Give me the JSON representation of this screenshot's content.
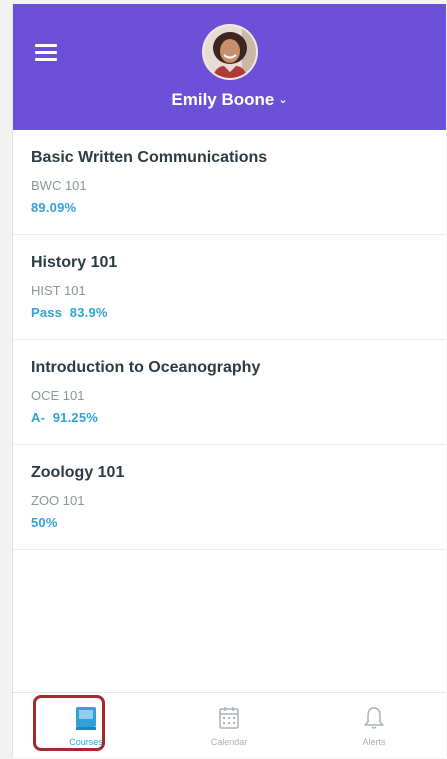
{
  "header": {
    "user_name": "Emily Boone",
    "chevron": "⌄",
    "background_color": "#6c51d8"
  },
  "courses": [
    {
      "title": "Basic Written Communications",
      "code": "BWC 101",
      "grade": "89.09%"
    },
    {
      "title": "History 101",
      "code": "HIST 101",
      "grade": "Pass  83.9%"
    },
    {
      "title": "Introduction to Oceanography",
      "code": "OCE 101",
      "grade": "A-  91.25%"
    },
    {
      "title": "Zoology 101",
      "code": "ZOO 101",
      "grade": "50%"
    }
  ],
  "tabbar": {
    "tabs": [
      {
        "label": "Courses",
        "icon": "courses-book-icon",
        "active": true
      },
      {
        "label": "Calendar",
        "icon": "calendar-icon",
        "active": false
      },
      {
        "label": "Alerts",
        "icon": "bell-icon",
        "active": false
      }
    ]
  },
  "colors": {
    "accent": "#2fa3d8",
    "highlight_box": "#a42a32"
  }
}
